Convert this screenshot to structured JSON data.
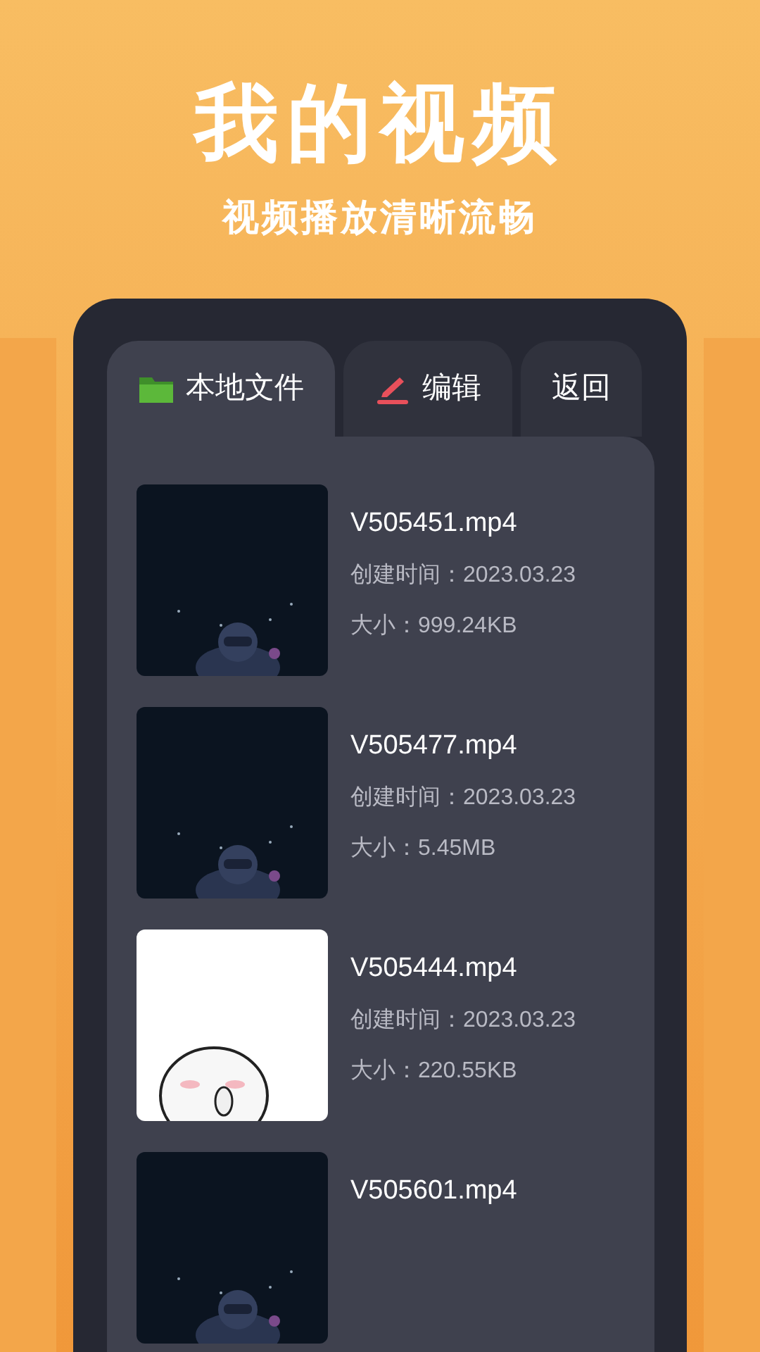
{
  "header": {
    "title": "我的视频",
    "subtitle": "视频播放清晰流畅"
  },
  "tabs": [
    {
      "label": "本地文件",
      "kind": "folder",
      "selected": true
    },
    {
      "label": "编辑",
      "kind": "edit",
      "selected": false
    },
    {
      "label": "返回",
      "selected": false
    }
  ],
  "videos": [
    {
      "kind": "space",
      "name": "V505451.mp4",
      "created": "创建时间：2023.03.23",
      "size": "大小：999.24KB"
    },
    {
      "kind": "space",
      "name": "V505477.mp4",
      "created": "创建时间：2023.03.23",
      "size": "大小：5.45MB"
    },
    {
      "kind": "light",
      "name": "V505444.mp4",
      "created": "创建时间：2023.03.23",
      "size": "大小：220.55KB"
    },
    {
      "kind": "space",
      "name": "V505601.mp4"
    }
  ]
}
